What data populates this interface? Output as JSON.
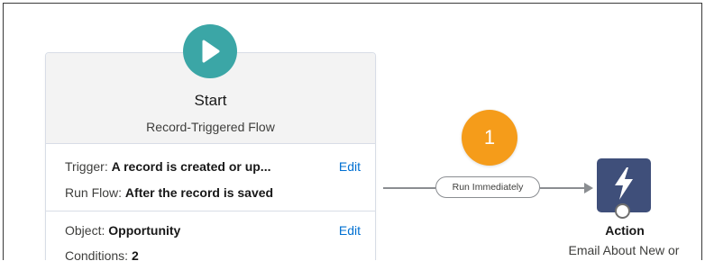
{
  "start": {
    "title": "Start",
    "subtitle": "Record-Triggered Flow",
    "trigger_label": "Trigger:",
    "trigger_value": "A record is created or up...",
    "run_flow_label": "Run Flow:",
    "run_flow_value": "After the record is saved",
    "edit_label": "Edit",
    "object_label": "Object:",
    "object_value": "Opportunity",
    "conditions_label": "Conditions:",
    "conditions_value": "2",
    "edit_label_2": "Edit"
  },
  "connector": {
    "label": "Run Immediately"
  },
  "badge": {
    "number": "1"
  },
  "action": {
    "title": "Action",
    "subtitle": "Email About New or"
  },
  "colors": {
    "play_teal": "#3ba6a6",
    "badge_orange": "#f59c1a",
    "action_navy": "#3f4f7a",
    "link_blue": "#0070d2"
  },
  "icons": {
    "start": "play-icon",
    "action": "lightning-bolt-icon"
  }
}
